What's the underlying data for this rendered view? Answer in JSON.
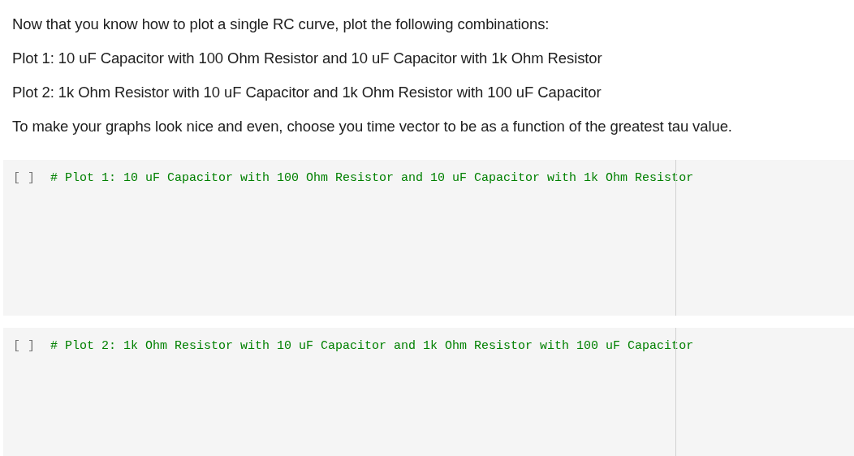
{
  "text_cell": {
    "paragraphs": [
      "Now that you know how to plot a single RC curve, plot the following combinations:",
      "Plot 1: 10 uF Capacitor with 100 Ohm Resistor and 10 uF Capacitor with 1k Ohm Resistor",
      "Plot 2: 1k Ohm Resistor with 10 uF Capacitor and 1k Ohm Resistor with 100 uF Capacitor",
      "To make your graphs look nice and even, choose you time vector to be as a function of the greatest tau value."
    ]
  },
  "code_cells": [
    {
      "execution_count": "[ ]",
      "code": "# Plot 1: 10 uF Capacitor with 100 Ohm Resistor and 10 uF Capacitor with 1k Ohm Resistor"
    },
    {
      "execution_count": "[ ]",
      "code": "# Plot 2: 1k Ohm Resistor with 10 uF Capacitor and 1k Ohm Resistor with 100 uF Capacitor"
    }
  ]
}
